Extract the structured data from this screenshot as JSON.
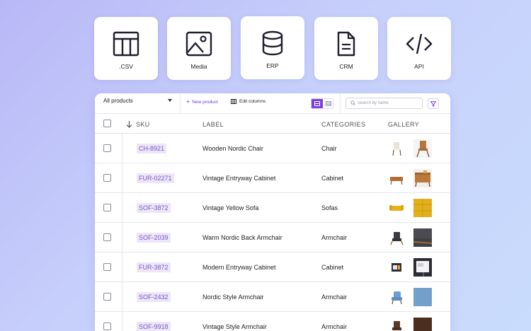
{
  "sources": [
    {
      "label": ".CSV",
      "icon": "table-icon"
    },
    {
      "label": "Media",
      "icon": "image-icon"
    },
    {
      "label": "ERP",
      "icon": "database-icon"
    },
    {
      "label": "CRM",
      "icon": "document-icon"
    },
    {
      "label": "API",
      "icon": "code-icon"
    }
  ],
  "toolbar": {
    "select_value": "All products",
    "new_product_label": "New product",
    "edit_columns_label": "Edit columns",
    "search_placeholder": "Search by name"
  },
  "table": {
    "headers": {
      "sku": "SKU",
      "label": "LABEL",
      "categories": "CATEGORIES",
      "gallery": "GALLERY"
    },
    "rows": [
      {
        "sku": "CH-8921",
        "label": "Wooden Nordic Chair",
        "category": "Chair"
      },
      {
        "sku": "FUR-02271",
        "label": "Vintage Entryway Cabinet",
        "category": "Cabinet"
      },
      {
        "sku": "SOF-3872",
        "label": "Vintage Yellow Sofa",
        "category": "Sofas"
      },
      {
        "sku": "SOF-2039",
        "label": "Warm Nordic Back Armchair",
        "category": "Armchair"
      },
      {
        "sku": "FUR-3872",
        "label": "Modern Entryway Cabinet",
        "category": "Cabinet"
      },
      {
        "sku": "SOF-2432",
        "label": "Nordic Style Armchair",
        "category": "Armchair"
      },
      {
        "sku": "SOF-9918",
        "label": "Vintage Style Armchair",
        "category": "Armchair"
      }
    ]
  },
  "colors": {
    "accent": "#7b3fe4",
    "sku_bg": "#ece6f7",
    "sku_text": "#7b57c9"
  }
}
